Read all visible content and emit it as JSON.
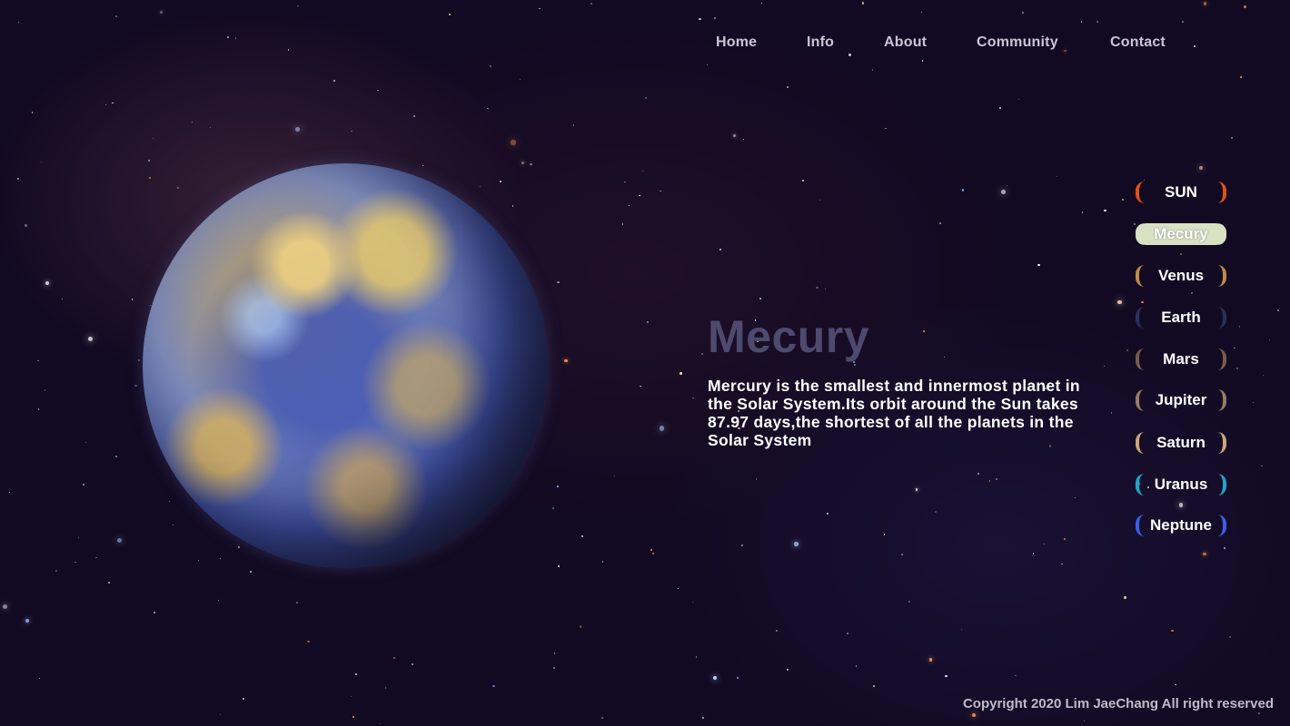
{
  "nav": {
    "items": [
      {
        "label": "Home"
      },
      {
        "label": "Info"
      },
      {
        "label": "About"
      },
      {
        "label": "Community"
      },
      {
        "label": "Contact"
      }
    ]
  },
  "hero": {
    "title": "Mecury",
    "description": "Mercury is the smallest and innermost planet in the Solar System.Its orbit around the Sun takes 87.97 days,the shortest of all the planets in the Solar System"
  },
  "planets": [
    {
      "label": "SUN",
      "color": "#e0511a"
    },
    {
      "label": "Mecury",
      "color": "#d9e1c3",
      "selected": true
    },
    {
      "label": "Venus",
      "color": "#c08a4a"
    },
    {
      "label": "Earth",
      "color": "#2c2f5c"
    },
    {
      "label": "Mars",
      "color": "#7a5b4a"
    },
    {
      "label": "Jupiter",
      "color": "#9a7b63"
    },
    {
      "label": "Saturn",
      "color": "#c9a879"
    },
    {
      "label": "Uranus",
      "color": "#21a6c6"
    },
    {
      "label": "Neptune",
      "color": "#3d5fe8"
    }
  ],
  "footer": {
    "copyright": "Copyright 2020 Lim JaeChang All right reserved"
  }
}
